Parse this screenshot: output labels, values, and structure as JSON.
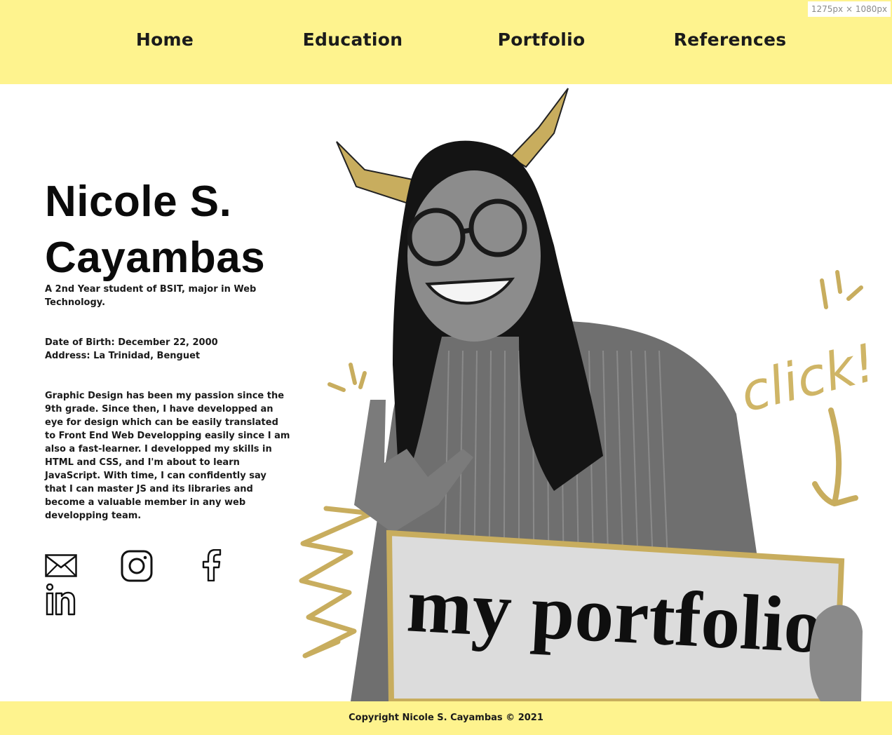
{
  "browser": {
    "viewport_label": "1275px × 1080px"
  },
  "nav": {
    "home": "Home",
    "education": "Education",
    "portfolio": "Portfolio",
    "references": "References"
  },
  "profile": {
    "name": "Nicole S. Cayambas",
    "subtitle": "A 2nd Year student of BSIT, major in Web Technology.",
    "date_of_birth": "Date of Birth: December 22, 2000",
    "address": "Address: La Trinidad, Benguet",
    "bio": "Graphic Design has been my passion since the 9th grade. Since then, I have developped an eye for design which can be easily translated to Front End Web Developping easily since I am also a fast-learner. I developped my skills in HTML and CSS, and I'm about to learn JavaScript. With time, I can confidently say that I can master JS and its libraries and become a valuable member in any web developping team."
  },
  "social": [
    "mail-icon",
    "instagram-icon",
    "facebook-icon",
    "linkedin-icon"
  ],
  "hero": {
    "sign_text": "my portfolio",
    "doodle_text": "click!"
  },
  "footer": {
    "copyright": "Copyright Nicole S. Cayambas © 2021"
  },
  "colors": {
    "header_bg": "#fef38e",
    "footer_bg": "#fef38e",
    "accent_gold": "#c8ad5e",
    "text": "#111111"
  }
}
